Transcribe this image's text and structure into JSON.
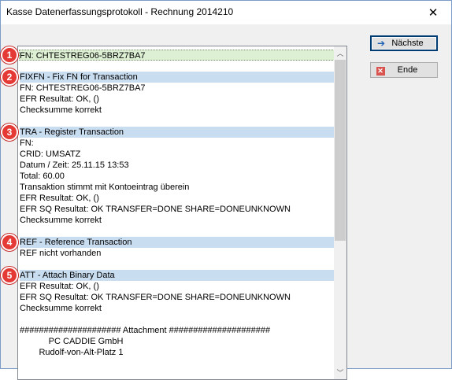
{
  "window": {
    "title": "Kasse Datenerfassungsprotokoll - Rechnung 2014210",
    "close_glyph": "✕"
  },
  "buttons": {
    "next_label": "Nächste",
    "end_label": "Ende"
  },
  "colors": {
    "header_band": "#c9ddf0",
    "selected_band": "#ddf0d4",
    "badge": "#e53935"
  },
  "badges": [
    "1",
    "2",
    "3",
    "4",
    "5"
  ],
  "log_lines": [
    "FN: CHTESTREG06-5BRZ7BA7",
    "",
    "FIXFN - Fix FN for Transaction",
    "FN: CHTESTREG06-5BRZ7BA7",
    "EFR Resultat: OK, ()",
    "Checksumme korrekt",
    "",
    "TRA - Register Transaction",
    "FN:",
    "CRID: UMSATZ",
    "Datum / Zeit: 25.11.15 13:53",
    "Total: 60.00",
    "Transaktion stimmt mit Kontoeintrag überein",
    "EFR Resultat: OK, ()",
    "EFR SQ Resultat: OK TRANSFER=DONE SHARE=DONEUNKNOWN",
    "Checksumme korrekt",
    "",
    "REF - Reference Transaction",
    "REF nicht vorhanden",
    "",
    "ATT - Attach Binary Data",
    "EFR Resultat: OK, ()",
    "EFR SQ Resultat: OK TRANSFER=DONE SHARE=DONEUNKNOWN",
    "Checksumme korrekt",
    "",
    "##################### Attachment #####################",
    "            PC CADDIE GmbH",
    "        Rudolf-von-Alt-Platz 1"
  ]
}
